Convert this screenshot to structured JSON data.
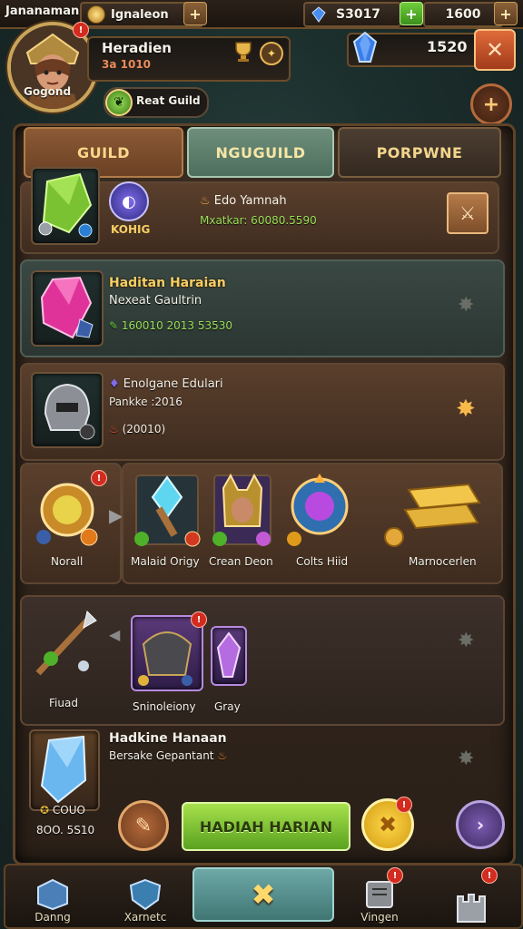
{
  "topbar": {
    "left_label": "Jananaman",
    "player_label": "Ignaleon",
    "currency1": "S3017",
    "currency2": "1600"
  },
  "profile": {
    "name": "Heradien",
    "power": "3a 1010",
    "avatar_caption": "Gogond",
    "guild_button": "Reat Guild",
    "gems": "1520"
  },
  "tabs": [
    {
      "label": "GUILD"
    },
    {
      "label": "NGUGUILD"
    },
    {
      "label": "PORPWNE"
    }
  ],
  "row1": {
    "name": "Edo Yamnah",
    "stat": "Mxatkar: 60080.5590",
    "sub": "KOHIG"
  },
  "row2": {
    "title": "Haditan Haraian",
    "subtitle": "Nexeat Gaultrin",
    "value": "160010 2013 53530"
  },
  "row3": {
    "title": "Enolgane Edulari",
    "subtitle": "Pankke :2016",
    "value": "(20010)"
  },
  "items_row": {
    "first_label": "Norall",
    "labels": [
      "Malaid Origy",
      "Crean Deon",
      "Colts Hiid",
      "Marnocerlen"
    ]
  },
  "row5": {
    "left_label": "Fiuad",
    "mid_label": "Sninoleiony",
    "right_label": "Gray"
  },
  "row6": {
    "title": "Hadkine Hanaan",
    "subtitle": "Bersake Gepantant",
    "coin1": "COUO",
    "coin2": "8OO. 5S10"
  },
  "actions": {
    "main_button": "HADIAH HARIAN"
  },
  "nav": [
    {
      "label": "Danng"
    },
    {
      "label": "Xarnetc"
    },
    {
      "label": ""
    },
    {
      "label": "Vingen"
    },
    {
      "label": ""
    }
  ],
  "colors": {
    "gold": "#f6cf63",
    "green_button": "#7cc43a",
    "panel": "#3a2c21"
  }
}
